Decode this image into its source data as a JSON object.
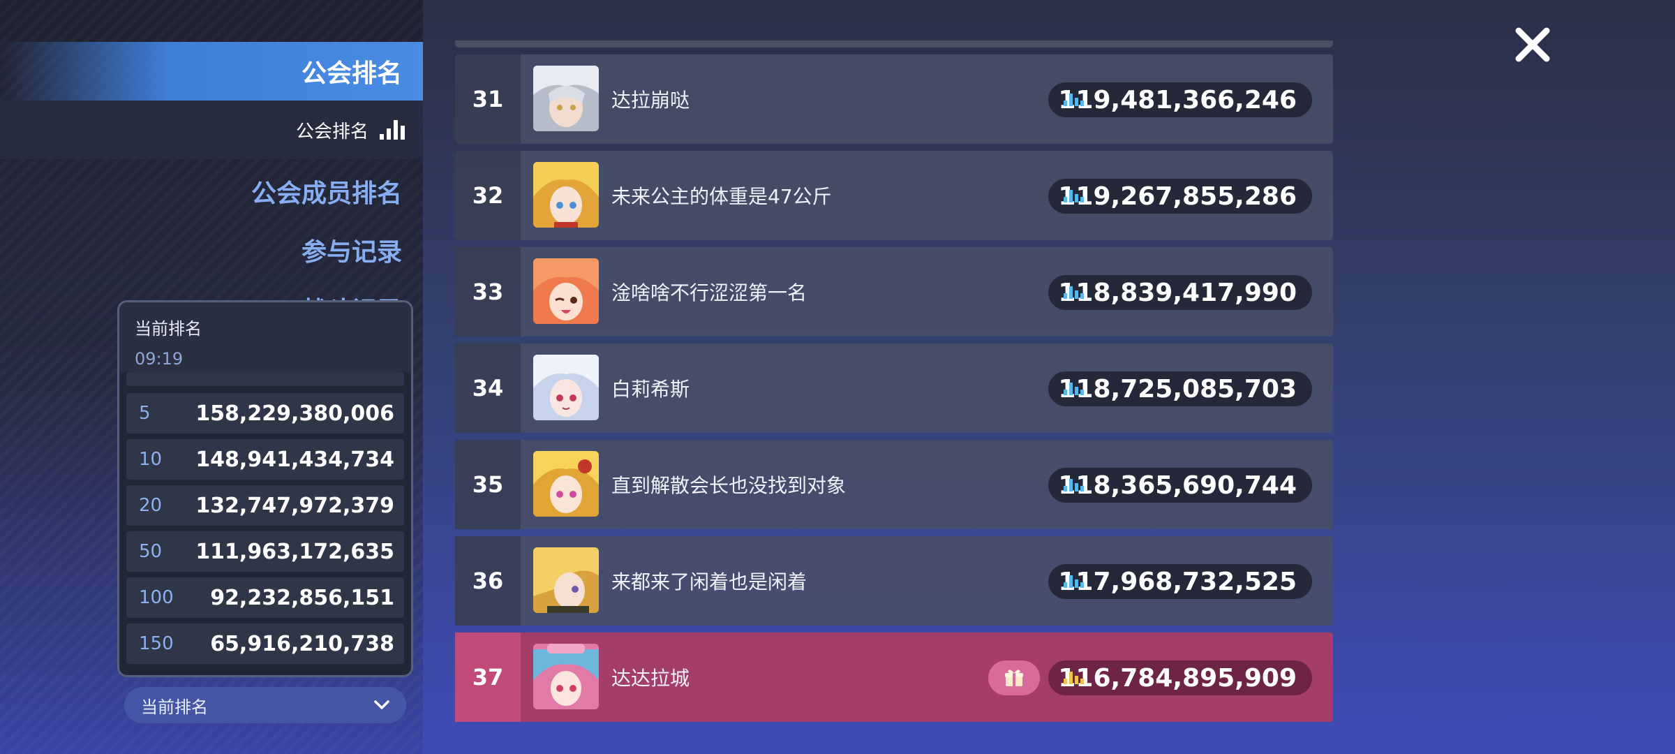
{
  "sidebar": {
    "active_tab": "公会排名",
    "subtab": "公会排名",
    "nav": [
      "公会成员排名",
      "参与记录",
      "战斗记录"
    ]
  },
  "popup": {
    "title": "当前排名",
    "time": "09:19",
    "rows": [
      {
        "rank": "5",
        "value": "158,229,380,006"
      },
      {
        "rank": "10",
        "value": "148,941,434,734"
      },
      {
        "rank": "20",
        "value": "132,747,972,379"
      },
      {
        "rank": "50",
        "value": "111,963,172,635"
      },
      {
        "rank": "100",
        "value": "92,232,856,151"
      },
      {
        "rank": "150",
        "value": "65,916,210,738"
      }
    ]
  },
  "dropdown": {
    "label": "当前排名"
  },
  "ranking": [
    {
      "rank": "31",
      "name": "达拉崩哒",
      "score": "119,481,366,246",
      "avatar": "silver-hair-avatar"
    },
    {
      "rank": "32",
      "name": "未来公主的体重是47公斤",
      "score": "119,267,855,286",
      "avatar": "blonde-princess-avatar"
    },
    {
      "rank": "33",
      "name": "淦啥啥不行涩涩第一名",
      "score": "118,839,417,990",
      "avatar": "orange-hair-wink-avatar"
    },
    {
      "rank": "34",
      "name": "白莉希斯",
      "score": "118,725,085,703",
      "avatar": "white-hair-avatar"
    },
    {
      "rank": "35",
      "name": "直到解散会长也没找到对象",
      "score": "118,365,690,744",
      "avatar": "blonde-pink-eye-avatar"
    },
    {
      "rank": "36",
      "name": "来都来了闲着也是闲着",
      "score": "117,968,732,525",
      "avatar": "blonde-cover-eye-avatar"
    },
    {
      "rank": "37",
      "name": "达达拉城",
      "score": "116,784,895,909",
      "avatar": "blue-hair-maid-avatar",
      "highlight": true
    }
  ],
  "colors": {
    "accent_blue": "#4a8be4",
    "my_row": "#a53d69",
    "score_icon": "#58b8ec",
    "my_score_icon": "#f0c24e"
  }
}
